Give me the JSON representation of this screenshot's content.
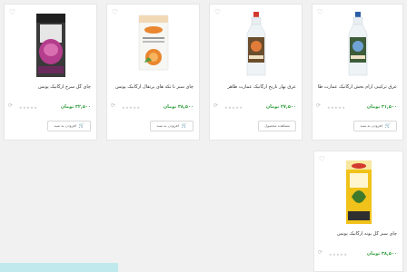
{
  "currency": "تومان",
  "cart_label": "افزودن به سبد",
  "products": [
    {
      "title": "چای گل سرخ ارگانیک پونس",
      "price": "۳۲,۵۰۰ تومان",
      "button": "افزودن به سبد",
      "colors": {
        "main": "#b53d8d"
      }
    },
    {
      "title": "چای سبز با تکه های پرتقال ارگانیک پونس",
      "price": "۳۸,۵۰۰ تومان",
      "button": "افزودن به سبد",
      "colors": {
        "main": "#e9862e"
      }
    },
    {
      "title": "عرق بهار نارنج ارگانیک عمارت طاهر",
      "price": "۲۷,۵۰۰ تومان",
      "button": "مشاهده محصول",
      "colors": {
        "main": "#d33a2e"
      }
    },
    {
      "title": "عرق ترکیبی آرام بخش ارگانیک عمارت طاهر",
      "price": "۳۱,۵۰۰ تومان",
      "button": "افزودن به سبد",
      "colors": {
        "main": "#2b5ea8"
      }
    },
    {
      "title": "چای سبز گل پونه ارگانیک پونس",
      "price": "۳۸,۵۰۰ تومان",
      "button": "",
      "colors": {
        "main": "#f0c21a"
      }
    }
  ]
}
